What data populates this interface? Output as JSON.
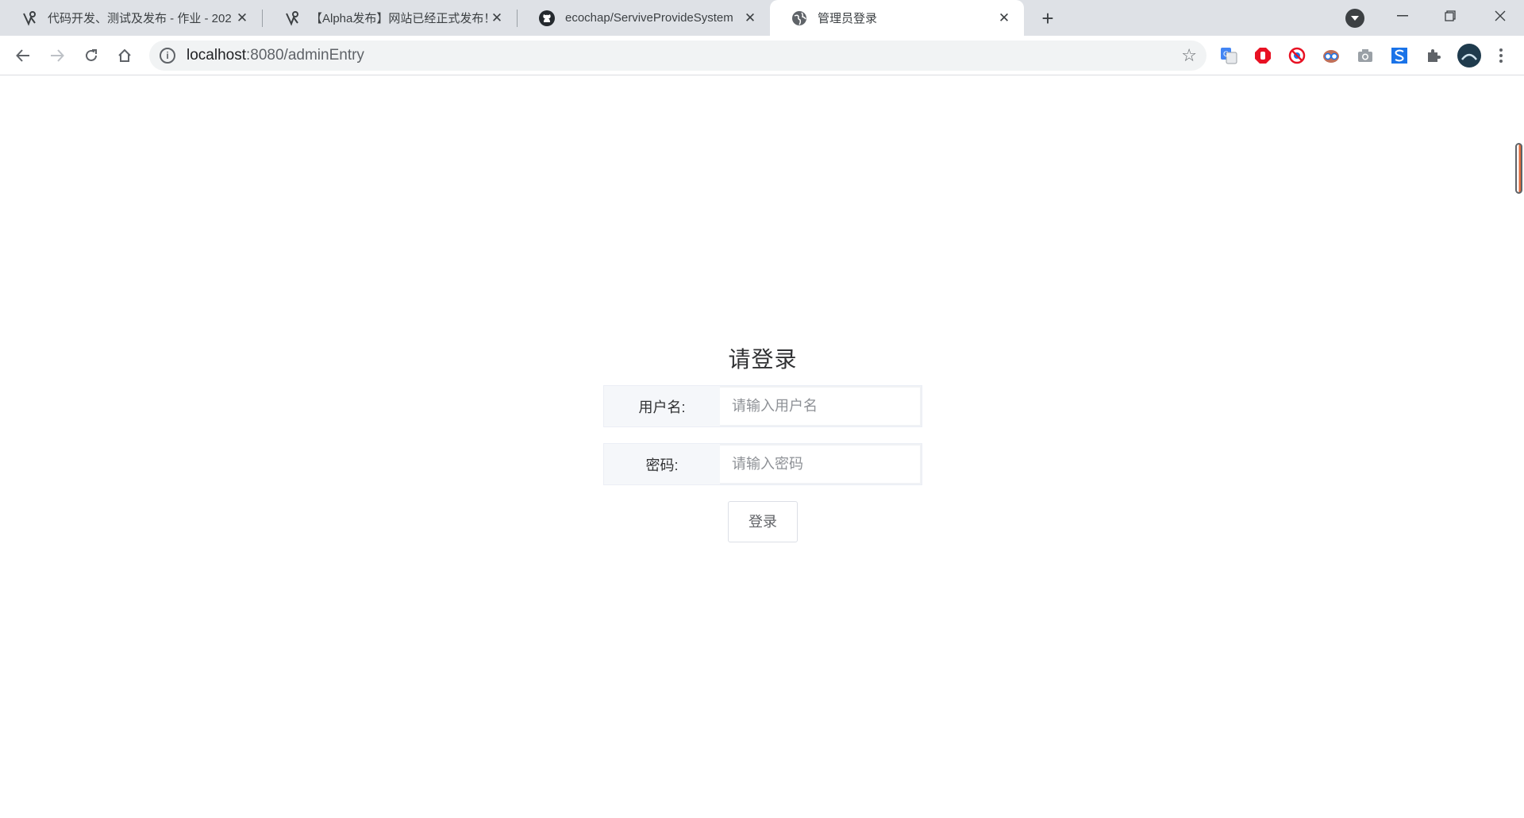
{
  "tabs": [
    {
      "title": "代码开发、测试及发布 - 作业 - 202",
      "icon": "dark-logo-icon"
    },
    {
      "title": "【Alpha发布】网站已经正式发布！",
      "icon": "dark-logo-icon"
    },
    {
      "title": "ecochap/ServiveProvideSystem",
      "icon": "github-icon"
    },
    {
      "title": "管理员登录",
      "icon": "globe-icon",
      "active": true
    }
  ],
  "toolbar": {
    "url_host": "localhost",
    "url_rest": ":8080/adminEntry"
  },
  "login": {
    "title": "请登录",
    "username_label": "用户名:",
    "username_placeholder": "请输入用户名",
    "password_label": "密码:",
    "password_placeholder": "请输入密码",
    "submit_label": "登录"
  },
  "colors": {
    "tab_strip": "#dee1e6",
    "omnibox": "#f1f3f4",
    "label_bg": "#f5f7fa"
  }
}
